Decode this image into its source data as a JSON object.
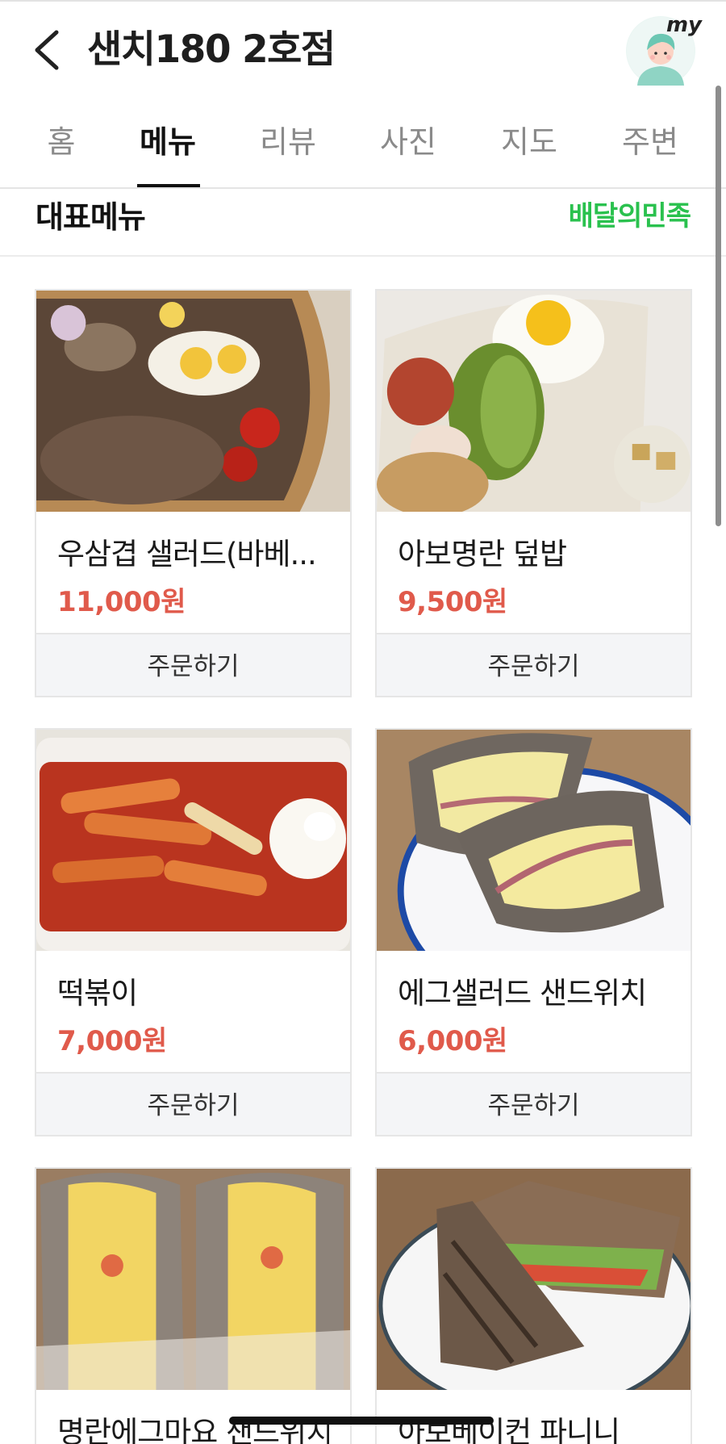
{
  "header": {
    "title": "샌치180 2호점",
    "my_label": "my"
  },
  "tabs": [
    {
      "label": "홈",
      "active": false
    },
    {
      "label": "메뉴",
      "active": true
    },
    {
      "label": "리뷰",
      "active": false
    },
    {
      "label": "사진",
      "active": false
    },
    {
      "label": "지도",
      "active": false
    },
    {
      "label": "주변",
      "active": false
    }
  ],
  "section": {
    "title": "대표메뉴",
    "delivery_link": "배달의민족"
  },
  "menu_items": [
    {
      "name": "우삼겹 샐러드(바베...",
      "price": "11,000원",
      "order_label": "주문하기",
      "image": "beef-salad-bowl"
    },
    {
      "name": "아보명란 덮밥",
      "price": "9,500원",
      "order_label": "주문하기",
      "image": "avocado-egg-rice-bowl"
    },
    {
      "name": "떡볶이",
      "price": "7,000원",
      "order_label": "주문하기",
      "image": "tteokbokki"
    },
    {
      "name": "에그샐러드 샌드위치",
      "price": "6,000원",
      "order_label": "주문하기",
      "image": "egg-salad-sandwich"
    },
    {
      "name": "명란에그마요 샌드위치",
      "price": "",
      "order_label": "",
      "image": "myeongran-egg-sandwich"
    },
    {
      "name": "아보베이컨 파니니",
      "price": "",
      "order_label": "",
      "image": "avocado-bacon-panini"
    }
  ],
  "colors": {
    "accent_green": "#2ac14e",
    "price_red": "#e05a4b",
    "button_bg": "#f4f5f7"
  },
  "icons": {
    "back": "chevron-left-icon",
    "avatar": "avatar-icon"
  }
}
